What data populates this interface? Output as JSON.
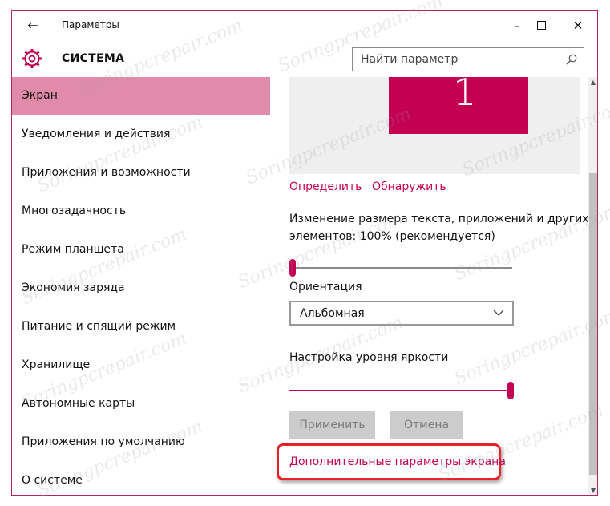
{
  "window": {
    "title": "Параметры"
  },
  "header": {
    "section_title": "СИСТЕМА",
    "search_placeholder": "Найти параметр"
  },
  "sidebar": {
    "items": [
      {
        "label": "Экран",
        "active": true
      },
      {
        "label": "Уведомления и действия"
      },
      {
        "label": "Приложения и возможности"
      },
      {
        "label": "Многозадачность"
      },
      {
        "label": "Режим планшета"
      },
      {
        "label": "Экономия заряда"
      },
      {
        "label": "Питание и спящий режим"
      },
      {
        "label": "Хранилище"
      },
      {
        "label": "Автономные карты"
      },
      {
        "label": "Приложения по умолчанию"
      },
      {
        "label": "О системе"
      }
    ]
  },
  "main": {
    "monitor_number": "1",
    "identify_link": "Определить",
    "detect_link": "Обнаружить",
    "scale_label_line1": "Изменение размера текста, приложений и других",
    "scale_label_line2": "элементов: 100% (рекомендуется)",
    "scale_value_fraction": 0.0,
    "orientation_label": "Ориентация",
    "orientation_value": "Альбомная",
    "brightness_label": "Настройка уровня яркости",
    "brightness_value_fraction": 1.0,
    "apply_button": "Применить",
    "cancel_button": "Отмена",
    "advanced_link": "Дополнительные параметры экрана"
  },
  "colors": {
    "accent": "#c30052",
    "active_nav": "#e08ba9",
    "frame": "#b3245f",
    "highlight_box": "#e8202a"
  },
  "watermark": "Soringpcrepair.com"
}
